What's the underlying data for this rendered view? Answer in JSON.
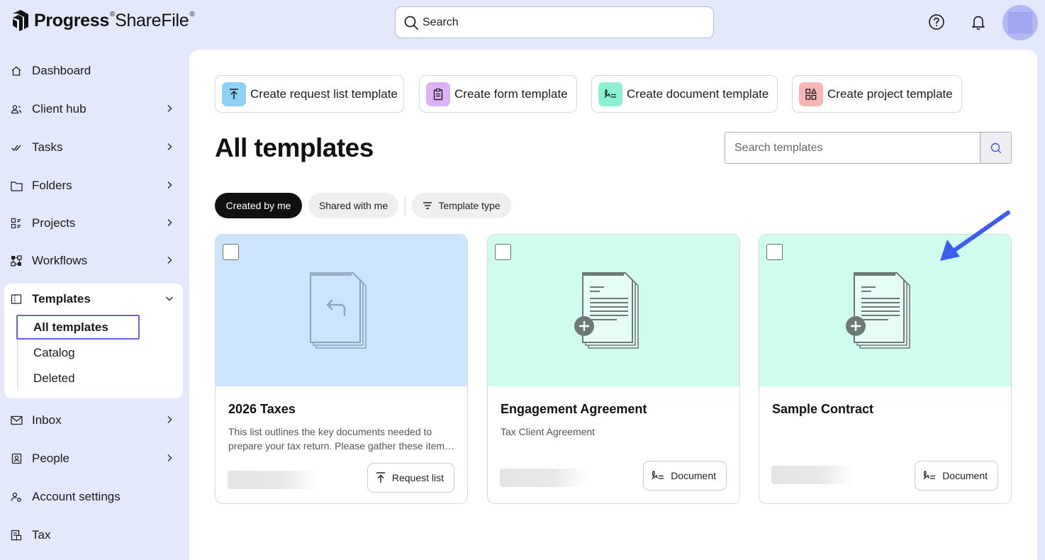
{
  "header": {
    "logo_brand": "Progress",
    "logo_product": "ShareFile",
    "search_placeholder": "Search",
    "help_icon": "help-circle-icon",
    "bell_icon": "bell-icon"
  },
  "sidebar": {
    "items": [
      {
        "label": "Dashboard",
        "icon": "home-icon"
      },
      {
        "label": "Client hub",
        "icon": "client-hub-icon"
      },
      {
        "label": "Tasks",
        "icon": "tasks-icon"
      },
      {
        "label": "Folders",
        "icon": "folder-icon"
      },
      {
        "label": "Projects",
        "icon": "projects-icon"
      },
      {
        "label": "Workflows",
        "icon": "workflows-icon"
      },
      {
        "label": "Templates",
        "icon": "templates-icon"
      },
      {
        "label": "Inbox",
        "icon": "inbox-icon"
      },
      {
        "label": "People",
        "icon": "people-icon"
      },
      {
        "label": "Account settings",
        "icon": "account-settings-icon"
      },
      {
        "label": "Tax",
        "icon": "tax-icon"
      }
    ],
    "templates_sub": [
      "All templates",
      "Catalog",
      "Deleted"
    ],
    "active_sub": "All templates"
  },
  "create_buttons": [
    {
      "label": "Create request list template",
      "icon": "upload-icon",
      "color": "#8fd0f7"
    },
    {
      "label": "Create form template",
      "icon": "clipboard-icon",
      "color": "#dcb2f4"
    },
    {
      "label": "Create document template",
      "icon": "signature-icon",
      "color": "#8ef0d2"
    },
    {
      "label": "Create project template",
      "icon": "shapes-icon",
      "color": "#f6b6b6"
    }
  ],
  "page": {
    "title": "All templates",
    "search_placeholder": "Search templates"
  },
  "filters": {
    "created_by_me": "Created by me",
    "shared_with_me": "Shared with me",
    "template_type": "Template type",
    "active": "Created by me"
  },
  "cards": [
    {
      "title": "2026 Taxes",
      "description": "This list outlines the key documents needed to prepare your tax return. Please gather these items and upload them here.",
      "type": "Request list",
      "type_icon": "upload-icon",
      "thumb_color": "#cbe6fc"
    },
    {
      "title": "Engagement Agreement",
      "description": "Tax Client Agreement",
      "type": "Document",
      "type_icon": "signature-icon",
      "thumb_color": "#cffcec"
    },
    {
      "title": "Sample Contract",
      "description": "",
      "type": "Document",
      "type_icon": "signature-icon",
      "thumb_color": "#cffcec"
    }
  ],
  "colors": {
    "page_bg": "#e4e8fb",
    "accent": "#6763e6",
    "arrow": "#3b5ef0"
  }
}
